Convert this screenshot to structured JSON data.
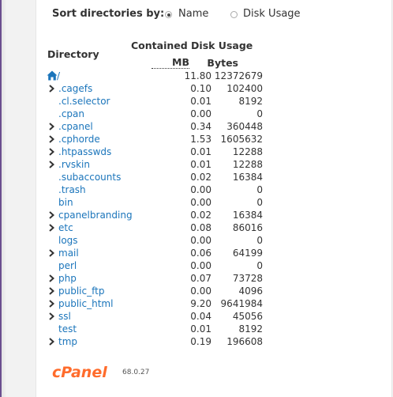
{
  "sort": {
    "label": "Sort directories by:",
    "options": [
      {
        "label": "Name",
        "selected": true
      },
      {
        "label": "Disk Usage",
        "selected": false
      }
    ]
  },
  "table": {
    "dir_header": "Directory",
    "usage_header": "Contained Disk Usage",
    "mb_header": "MB",
    "bytes_header": "Bytes",
    "rows": [
      {
        "name": "/",
        "mb": "11.80",
        "bytes": "12372679",
        "expandable": false,
        "home": true
      },
      {
        "name": ".cagefs",
        "mb": "0.10",
        "bytes": "102400",
        "expandable": true
      },
      {
        "name": ".cl.selector",
        "mb": "0.01",
        "bytes": "8192",
        "expandable": false
      },
      {
        "name": ".cpan",
        "mb": "0.00",
        "bytes": "0",
        "expandable": false
      },
      {
        "name": ".cpanel",
        "mb": "0.34",
        "bytes": "360448",
        "expandable": true
      },
      {
        "name": ".cphorde",
        "mb": "1.53",
        "bytes": "1605632",
        "expandable": true
      },
      {
        "name": ".htpasswds",
        "mb": "0.01",
        "bytes": "12288",
        "expandable": true
      },
      {
        "name": ".rvskin",
        "mb": "0.01",
        "bytes": "12288",
        "expandable": true
      },
      {
        "name": ".subaccounts",
        "mb": "0.02",
        "bytes": "16384",
        "expandable": false
      },
      {
        "name": ".trash",
        "mb": "0.00",
        "bytes": "0",
        "expandable": false
      },
      {
        "name": "bin",
        "mb": "0.00",
        "bytes": "0",
        "expandable": false
      },
      {
        "name": "cpanelbranding",
        "mb": "0.02",
        "bytes": "16384",
        "expandable": true
      },
      {
        "name": "etc",
        "mb": "0.08",
        "bytes": "86016",
        "expandable": true
      },
      {
        "name": "logs",
        "mb": "0.00",
        "bytes": "0",
        "expandable": false
      },
      {
        "name": "mail",
        "mb": "0.06",
        "bytes": "64199",
        "expandable": true
      },
      {
        "name": "perl",
        "mb": "0.00",
        "bytes": "0",
        "expandable": false
      },
      {
        "name": "php",
        "mb": "0.07",
        "bytes": "73728",
        "expandable": true
      },
      {
        "name": "public_ftp",
        "mb": "0.00",
        "bytes": "4096",
        "expandable": true
      },
      {
        "name": "public_html",
        "mb": "9.20",
        "bytes": "9641984",
        "expandable": true
      },
      {
        "name": "ssl",
        "mb": "0.04",
        "bytes": "45056",
        "expandable": true
      },
      {
        "name": "test",
        "mb": "0.01",
        "bytes": "8192",
        "expandable": false
      },
      {
        "name": "tmp",
        "mb": "0.19",
        "bytes": "196608",
        "expandable": true
      }
    ]
  },
  "footer": {
    "brand": "cPanel",
    "version": "68.0.27"
  },
  "colors": {
    "link": "#1b75bb",
    "brand": "#ff6c2c",
    "sidebar_edge": "#6b4e8f"
  }
}
